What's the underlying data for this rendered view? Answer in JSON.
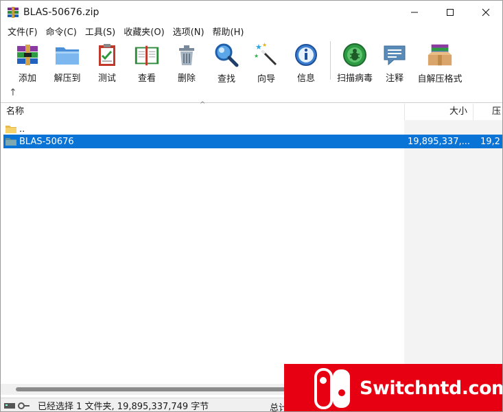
{
  "window": {
    "title": "BLAS-50676.zip",
    "controls": {
      "minimize": "—",
      "maximize": "☐",
      "close": "✕"
    }
  },
  "menu": [
    "文件(F)",
    "命令(C)",
    "工具(S)",
    "收藏夹(O)",
    "选项(N)",
    "帮助(H)"
  ],
  "toolbar": {
    "buttons": [
      {
        "label": "添加",
        "icon": "add-archive-icon"
      },
      {
        "label": "解压到",
        "icon": "extract-folder-icon"
      },
      {
        "label": "测试",
        "icon": "test-clipboard-icon"
      },
      {
        "label": "查看",
        "icon": "view-book-icon"
      },
      {
        "label": "删除",
        "icon": "delete-trash-icon"
      },
      {
        "label": "查找",
        "icon": "find-magnifier-icon"
      },
      {
        "label": "向导",
        "icon": "wizard-wand-icon"
      },
      {
        "label": "信息",
        "icon": "info-icon"
      },
      {
        "label": "扫描病毒",
        "icon": "virus-scan-icon"
      },
      {
        "label": "注释",
        "icon": "comment-icon"
      },
      {
        "label": "自解压格式",
        "icon": "sfx-box-icon"
      }
    ]
  },
  "pathbar": {
    "up_icon": "↑"
  },
  "columns": {
    "name": "名称",
    "size": "大小",
    "packed": "压"
  },
  "files": [
    {
      "name": "..",
      "type": "parent",
      "size": "",
      "packed": ""
    },
    {
      "name": "BLAS-50676",
      "type": "folder",
      "size": "19,895,337,...",
      "packed": "19,2",
      "selected": true
    }
  ],
  "status": {
    "selection": "已经选择 1 文件夹, 19,895,337,749 字节",
    "total": "总计"
  },
  "watermark": {
    "text": "Switchntd.com"
  },
  "colors": {
    "selection": "#0a74d6",
    "watermark_bg": "#e60012"
  }
}
